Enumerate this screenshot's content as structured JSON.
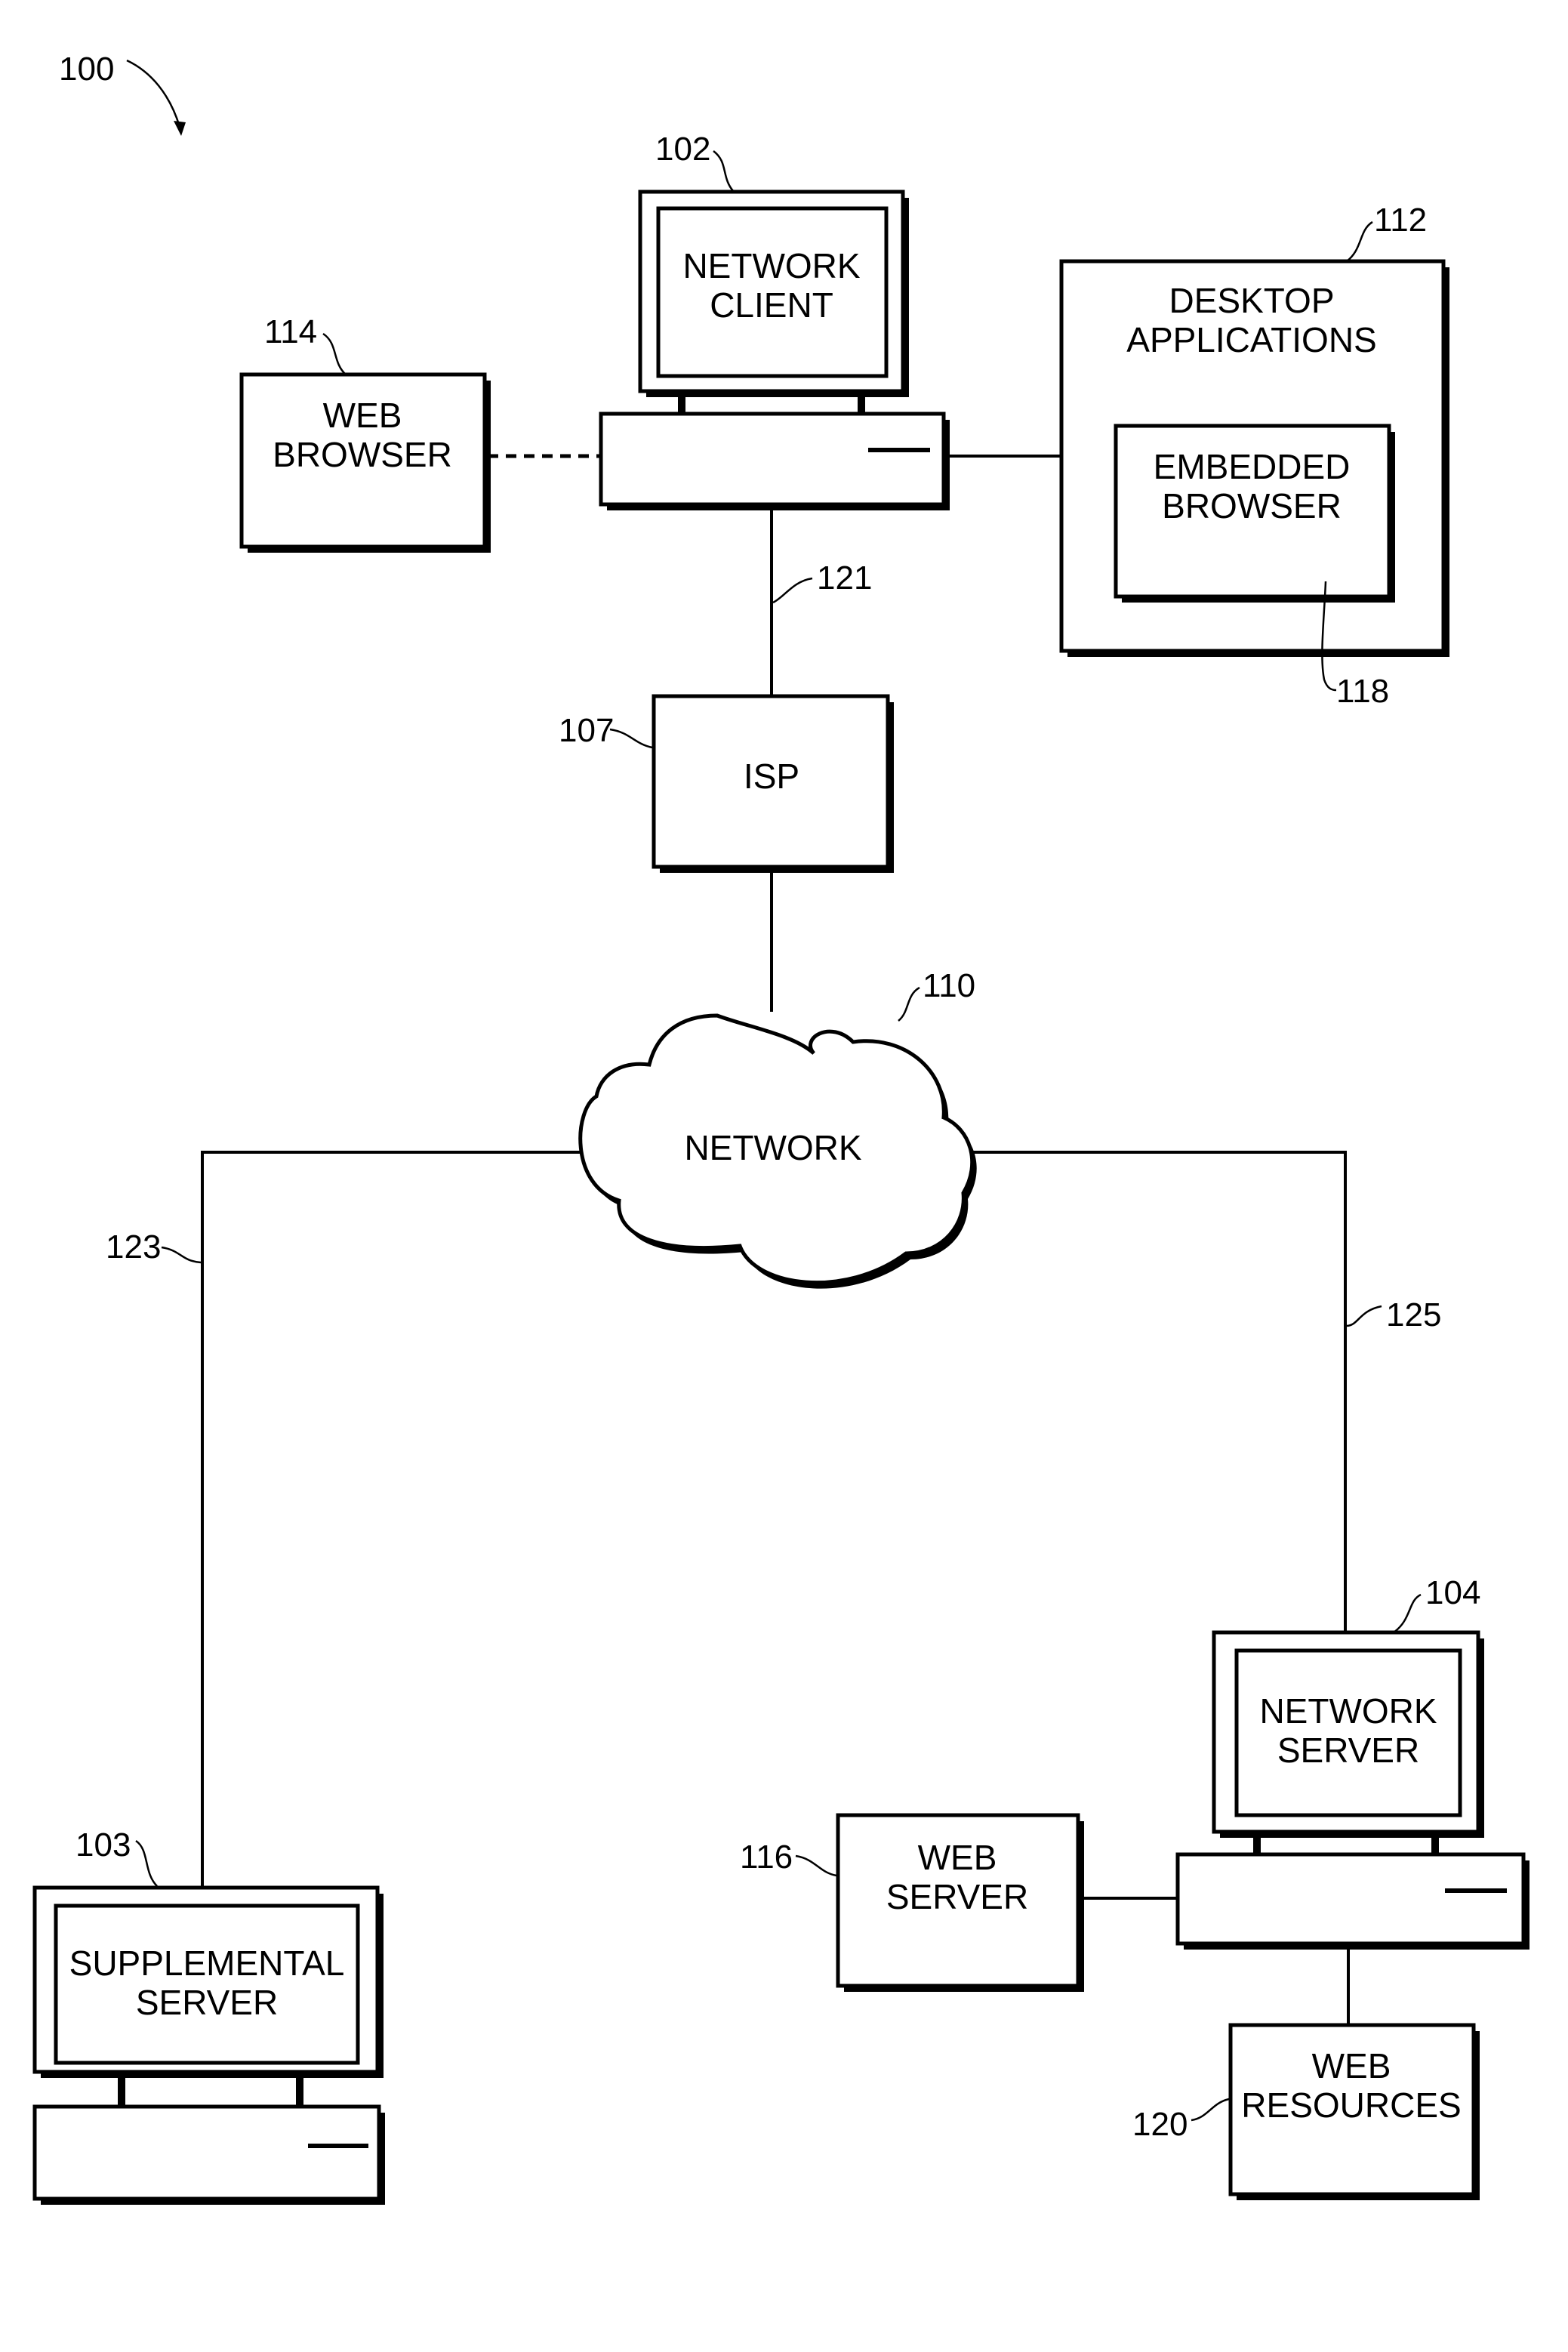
{
  "figure": {
    "reference": "100",
    "nodes": {
      "network_client": {
        "ref": "102",
        "lines": [
          "NETWORK",
          "CLIENT"
        ]
      },
      "web_browser": {
        "ref": "114",
        "lines": [
          "WEB",
          "BROWSER"
        ]
      },
      "desktop_applications": {
        "ref": "112",
        "lines": [
          "DESKTOP",
          "APPLICATIONS"
        ]
      },
      "embedded_browser": {
        "ref": "118",
        "lines": [
          "EMBEDDED",
          "BROWSER"
        ]
      },
      "isp": {
        "ref": "107",
        "lines": [
          "ISP"
        ]
      },
      "network": {
        "ref": "110",
        "lines": [
          "NETWORK"
        ]
      },
      "supplemental_server": {
        "ref": "103",
        "lines": [
          "SUPPLEMENTAL",
          "SERVER"
        ]
      },
      "network_server": {
        "ref": "104",
        "lines": [
          "NETWORK",
          "SERVER"
        ]
      },
      "web_server": {
        "ref": "116",
        "lines": [
          "WEB",
          "SERVER"
        ]
      },
      "web_resources": {
        "ref": "120",
        "lines": [
          "WEB",
          "RESOURCES"
        ]
      }
    },
    "links": {
      "client_to_isp": {
        "ref": "121"
      },
      "network_to_supplemental": {
        "ref": "123"
      },
      "network_to_server": {
        "ref": "125"
      }
    }
  }
}
